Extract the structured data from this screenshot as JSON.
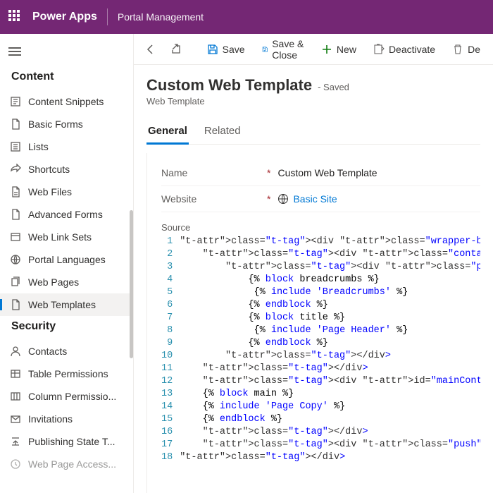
{
  "topbar": {
    "brand": "Power Apps",
    "section": "Portal Management"
  },
  "sidebar": {
    "groups": [
      {
        "label": "Content",
        "items": [
          {
            "label": "Content Snippets",
            "icon": "snippet"
          },
          {
            "label": "Basic Forms",
            "icon": "doc"
          },
          {
            "label": "Lists",
            "icon": "list"
          },
          {
            "label": "Shortcuts",
            "icon": "shortcut"
          },
          {
            "label": "Web Files",
            "icon": "file"
          },
          {
            "label": "Advanced Forms",
            "icon": "doc"
          },
          {
            "label": "Web Link Sets",
            "icon": "linkset"
          },
          {
            "label": "Portal Languages",
            "icon": "lang"
          },
          {
            "label": "Web Pages",
            "icon": "pages"
          },
          {
            "label": "Web Templates",
            "icon": "template",
            "selected": true
          }
        ]
      },
      {
        "label": "Security",
        "items": [
          {
            "label": "Contacts",
            "icon": "contact"
          },
          {
            "label": "Table Permissions",
            "icon": "table"
          },
          {
            "label": "Column Permissio...",
            "icon": "column"
          },
          {
            "label": "Invitations",
            "icon": "invite"
          },
          {
            "label": "Publishing State T...",
            "icon": "publish"
          },
          {
            "label": "Web Page Access...",
            "icon": "access",
            "cut": true
          }
        ]
      }
    ]
  },
  "commands": {
    "save": "Save",
    "saveClose": "Save & Close",
    "new": "New",
    "deactivate": "Deactivate",
    "delete": "De"
  },
  "header": {
    "title": "Custom Web Template",
    "status": "- Saved",
    "entity": "Web Template"
  },
  "tabs": {
    "general": "General",
    "related": "Related"
  },
  "form": {
    "nameLabel": "Name",
    "nameValue": "Custom Web Template",
    "websiteLabel": "Website",
    "websiteValue": "Basic Site",
    "sourceLabel": "Source"
  },
  "code": [
    "<div class=\"wrapper-body\">",
    "    <div class=\"container\">",
    "        <div class=\"page-heading\">",
    "            {% block breadcrumbs %}",
    "             {% include 'Breadcrumbs' %}",
    "            {% endblock %}",
    "            {% block title %}",
    "             {% include 'Page Header' %}",
    "            {% endblock %}",
    "        </div>",
    "    </div>",
    "    <div id=\"mainContent\">",
    "    {% block main %}",
    "    {% include 'Page Copy' %}",
    "    {% endblock %}",
    "    </div>",
    "    <div class=\"push\"></div>",
    "</div>"
  ]
}
